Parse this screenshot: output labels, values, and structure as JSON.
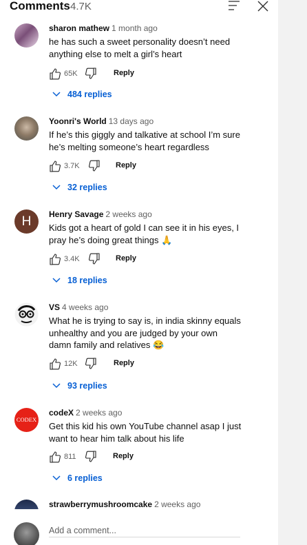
{
  "header": {
    "title": "Comments",
    "count": "4.7K"
  },
  "comments": [
    {
      "author": "sharon mathew",
      "time": "1 month ago",
      "text": "he has such a sweet personality doesn’t need anything else to melt a girl’s heart",
      "likes": "65K",
      "reply_label": "Reply",
      "replies": "484 replies"
    },
    {
      "author": "Yoonri's World",
      "time": "13 days ago",
      "text": "If he’s this giggly and talkative at school I’m sure he’s melting someone’s heart regardless",
      "likes": "3.7K",
      "reply_label": "Reply",
      "replies": "32 replies"
    },
    {
      "author": "Henry Savage",
      "time": "2 weeks ago",
      "text": "Kids got a heart of gold I can see it in his eyes, I pray he’s doing great things 🙏",
      "likes": "3.4K",
      "reply_label": "Reply",
      "replies": "18 replies",
      "avatar_letter": "H"
    },
    {
      "author": "VS",
      "time": "4 weeks ago",
      "text": "What he is trying to say is, in india skinny equals unhealthy and you are judged by your own damn family and relatives 😂",
      "likes": "12K",
      "reply_label": "Reply",
      "replies": "93 replies"
    },
    {
      "author": "codeX",
      "time": "2 weeks ago",
      "text": "Get this kid his own YouTube channel asap I just want to hear him talk about his life",
      "likes": "811",
      "reply_label": "Reply",
      "replies": "6 replies",
      "avatar_text": "CODEX"
    },
    {
      "author": "strawberrymushroomcake",
      "time": "2 weeks ago"
    }
  ],
  "add_comment": {
    "placeholder": "Add a comment..."
  },
  "colors": {
    "link": "#065fd4",
    "meta": "#606060",
    "henry_avatar": "#6b3a2a",
    "codex_avatar": "#e62117"
  }
}
